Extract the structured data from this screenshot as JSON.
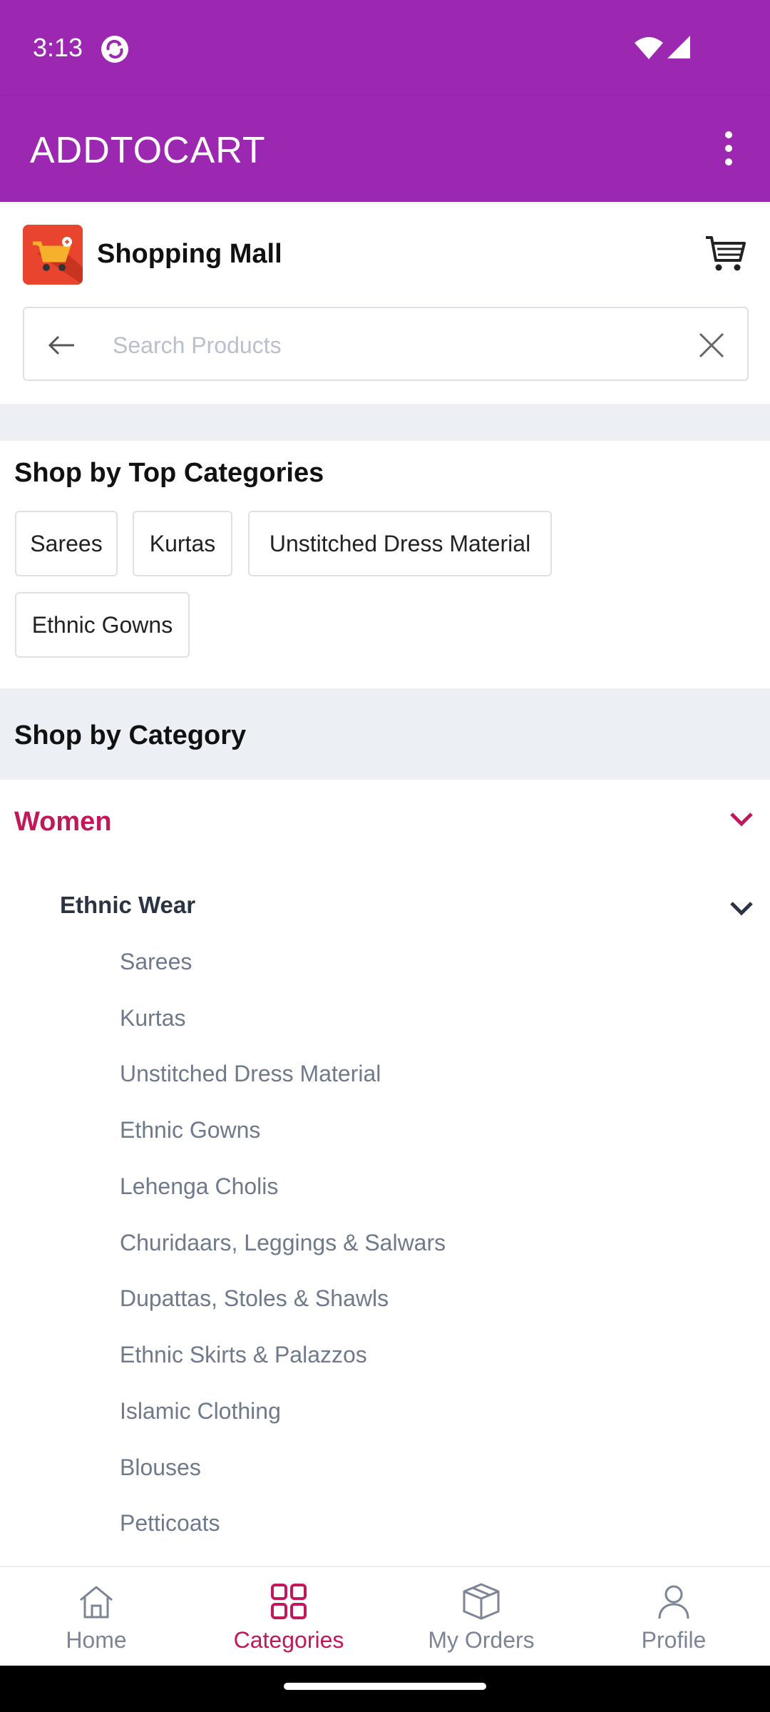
{
  "status_bar": {
    "time": "3:13"
  },
  "app_bar": {
    "title": "ADDTOCART"
  },
  "store": {
    "name": "Shopping Mall"
  },
  "search": {
    "placeholder": "Search Products",
    "value": ""
  },
  "top_categories": {
    "title": "Shop by Top Categories",
    "items": [
      "Sarees",
      "Kurtas",
      "Unstitched Dress Material",
      "Ethnic Gowns"
    ]
  },
  "categories": {
    "title": "Shop by Category",
    "main": "Women",
    "sub_group": "Ethnic Wear",
    "sub_items": [
      "Sarees",
      "Kurtas",
      "Unstitched Dress Material",
      "Ethnic Gowns",
      "Lehenga Cholis",
      "Churidaars, Leggings & Salwars",
      "Dupattas, Stoles & Shawls",
      "Ethnic Skirts & Palazzos",
      "Islamic Clothing",
      "Blouses",
      "Petticoats"
    ]
  },
  "bottom_nav": {
    "items": [
      "Home",
      "Categories",
      "My Orders",
      "Profile"
    ],
    "active": "Categories"
  },
  "colors": {
    "primary": "#9c27b0",
    "accent": "#c2185b",
    "band": "#eceff3"
  }
}
